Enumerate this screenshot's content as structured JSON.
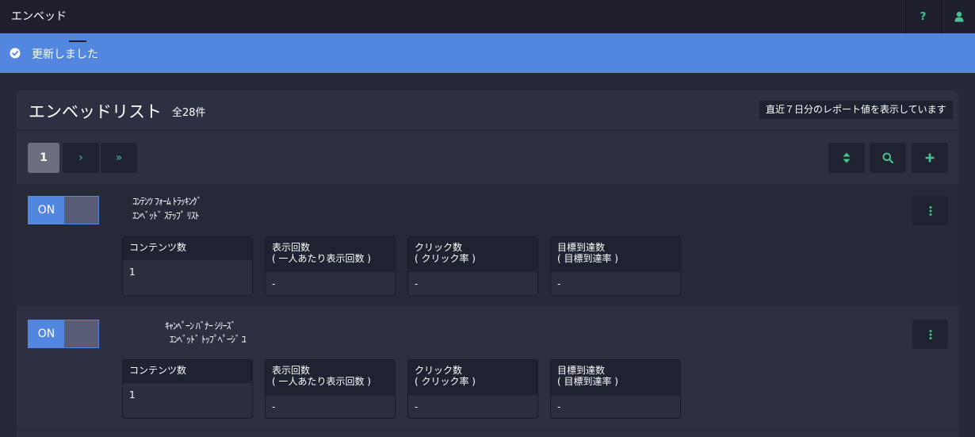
{
  "app": {
    "title": "エンベッド"
  },
  "header": {
    "help_icon": "question-icon",
    "user_icon": "user-icon"
  },
  "alert": {
    "message": "更新しました",
    "icon": "check-circle-icon",
    "color": "#5286df"
  },
  "panel": {
    "title": "エンベッドリスト",
    "count": "全28件",
    "report_note": "直近７日分のレポート値を表示しています"
  },
  "pagination": {
    "current_page": "1",
    "next_label": "›",
    "last_label": "»"
  },
  "toolbar": {
    "sort_icon": "sort-icon",
    "search_icon": "search-icon",
    "add_icon": "plus-icon"
  },
  "stat_labels": {
    "contents": "コンテンツ数",
    "impressions": "表示回数",
    "impressions_sub": "( 一人あたり表示回数 )",
    "clicks": "クリック数",
    "clicks_sub": "( クリック率 )",
    "goals": "目標到達数",
    "goals_sub": "( 目標到達率 )"
  },
  "items": [
    {
      "toggle": "ON",
      "name_line1": "ｺﾝﾃﾝﾂ ﾌｫｰﾑ ﾄﾗｯｷﾝｸﾞ",
      "name_line2": "ｴﾝﾍﾞｯﾄﾞ ｽﾃｯﾌﾟ ﾘｽﾄ",
      "contents": "1",
      "impressions": "-",
      "clicks": "-",
      "goals": "-"
    },
    {
      "toggle": "ON",
      "name_line1": "ｷｬﾝﾍﾟｰﾝ ﾊﾞﾅｰ ｼﾘｰｽﾞ",
      "name_line2": "ｴﾝﾍﾞｯﾄﾞ ﾄｯﾌﾟﾍﾟｰｼﾞ ﾕ",
      "contents": "1",
      "impressions": "-",
      "clicks": "-",
      "goals": "-"
    }
  ],
  "colors": {
    "accent_green": "#47c18f",
    "accent_blue": "#5286df",
    "background": "#252837"
  }
}
